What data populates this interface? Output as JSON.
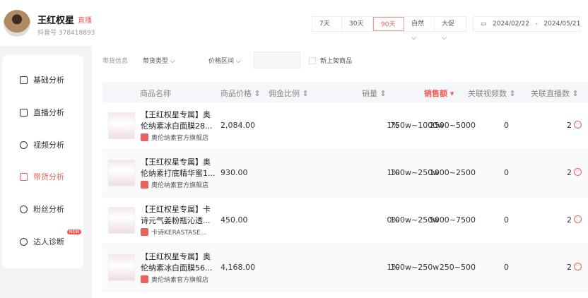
{
  "profile": {
    "name": "王红权星",
    "live_tag": "直播",
    "douyin_id": "抖音号 378418893"
  },
  "ranges": [
    "7天",
    "30天",
    "90天"
  ],
  "active_range": "90天",
  "dropdowns": [
    "自然",
    "大促"
  ],
  "date_range": {
    "start": "2024/02/22",
    "sep": "-",
    "end": "2024/05/21"
  },
  "sidebar": [
    {
      "label": "基础分析"
    },
    {
      "label": "直播分析"
    },
    {
      "label": "视频分析"
    },
    {
      "label": "带货分析"
    },
    {
      "label": "粉丝分析"
    },
    {
      "label": "达人诊断",
      "badge": "NEW"
    }
  ],
  "filters": {
    "section": "带货信息",
    "type": "带货类型",
    "price": "价格区间",
    "new_only": "新上架商品"
  },
  "columns": [
    "商品名称",
    "商品价格",
    "佣金比例",
    "销量",
    "销售额",
    "关联视频数",
    "关联直播数"
  ],
  "rows": [
    {
      "name": "【王红权星专属】奥伦纳素冰白面膜28...",
      "shop": "奥伦纳素官方旗舰店",
      "price": "2,084.00",
      "commission": "1%",
      "sales": "2500~5000",
      "amount": "750w~1000w",
      "videos": "0",
      "lives": "2"
    },
    {
      "name": "【王红权星专属】奥伦纳素打底精华蜜1...",
      "shop": "奥伦纳素官方旗舰店",
      "price": "930.00",
      "commission": "1%",
      "sales": "1000~2500",
      "amount": "100w~250w",
      "videos": "0",
      "lives": "2"
    },
    {
      "name": "【王红权星专属】卡诗元气姜粉瓶沁透...",
      "shop": "卡诗KERASTASE...",
      "price": "450.00",
      "commission": "0%",
      "sales": "5000~7500",
      "amount": "100w~250w",
      "videos": "0",
      "lives": "2"
    },
    {
      "name": "【王红权星专属】奥伦纳素冰白面膜56...",
      "shop": "奥伦纳素官方旗舰店",
      "price": "4,168.00",
      "commission": "1%",
      "sales": "250~500",
      "amount": "100w~250w",
      "videos": "0",
      "lives": "2"
    }
  ]
}
